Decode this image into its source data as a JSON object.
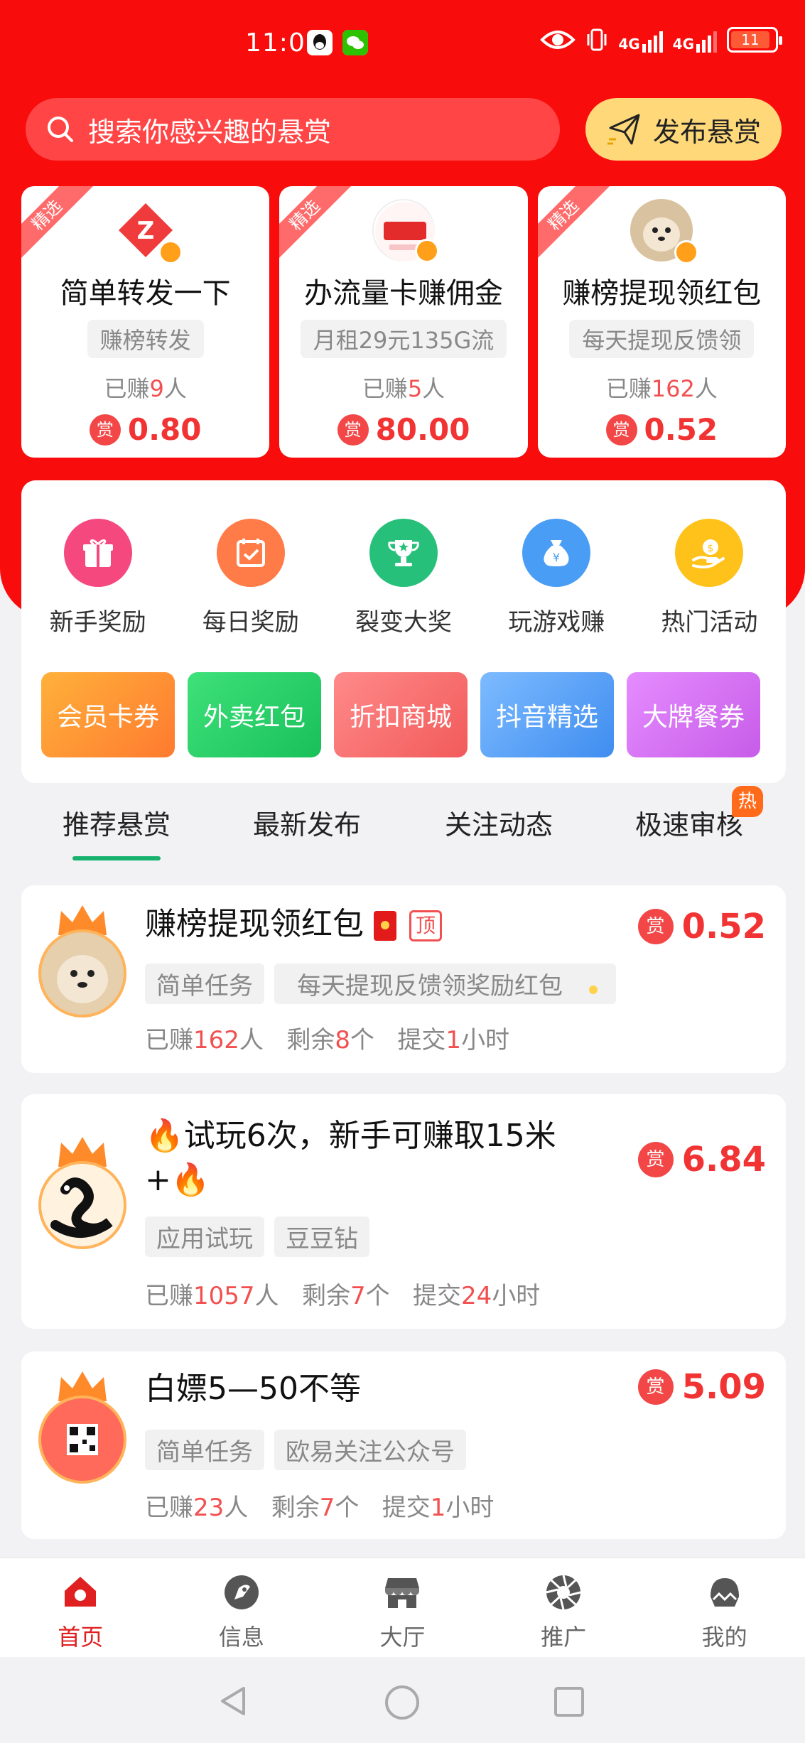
{
  "status_bar": {
    "time": "11:03",
    "net1": "4G",
    "net2": "4G",
    "battery": "11"
  },
  "search": {
    "placeholder": "搜索你感兴趣的悬赏"
  },
  "publish_button": "发布悬赏",
  "featured": [
    {
      "badge": "精选",
      "title": "简单转发一下",
      "tag": "赚榜转发",
      "earned_prefix": "已赚",
      "earned_count": "9",
      "earned_suffix": "人",
      "reward_icon": "赏",
      "amount": "0.80"
    },
    {
      "badge": "精选",
      "title": "办流量卡赚佣金",
      "tag": "月租29元135G流",
      "earned_prefix": "已赚",
      "earned_count": "5",
      "earned_suffix": "人",
      "reward_icon": "赏",
      "amount": "80.00"
    },
    {
      "badge": "精选",
      "title": "赚榜提现领红包",
      "tag": "每天提现反馈领",
      "earned_prefix": "已赚",
      "earned_count": "162",
      "earned_suffix": "人",
      "reward_icon": "赏",
      "amount": "0.52"
    }
  ],
  "quick_actions": [
    {
      "label": "新手奖励",
      "icon": "gift-icon",
      "color": "#f5487f"
    },
    {
      "label": "每日奖励",
      "icon": "calendar-check-icon",
      "color": "#ff7b47"
    },
    {
      "label": "裂变大奖",
      "icon": "trophy-icon",
      "color": "#27c07a"
    },
    {
      "label": "玩游戏赚",
      "icon": "money-bag-icon",
      "color": "#4a9df5"
    },
    {
      "label": "热门活动",
      "icon": "coin-hand-icon",
      "color": "#ffc21a"
    }
  ],
  "promo_pills": [
    "会员卡券",
    "外卖红包",
    "折扣商城",
    "抖音精选",
    "大牌餐券"
  ],
  "tabs": [
    "推荐悬赏",
    "最新发布",
    "关注动态",
    "极速审核"
  ],
  "hot_badge": "热",
  "tasks": [
    {
      "title": "赚榜提现领红包",
      "pin": "顶",
      "tags": [
        "简单任务",
        "每天提现反馈领奖励红包"
      ],
      "earned_label": "已赚",
      "earned": "162",
      "earned_unit": "人",
      "remain_label": "剩余",
      "remain": "8",
      "remain_unit": "个",
      "submit_label": "提交",
      "submit": "1",
      "submit_unit": "小时",
      "reward_icon": "赏",
      "amount": "0.52"
    },
    {
      "title": "🔥试玩6次，新手可赚取15米",
      "title2": "+🔥",
      "tags": [
        "应用试玩",
        "豆豆钻"
      ],
      "earned_label": "已赚",
      "earned": "1057",
      "earned_unit": "人",
      "remain_label": "剩余",
      "remain": "7",
      "remain_unit": "个",
      "submit_label": "提交",
      "submit": "24",
      "submit_unit": "小时",
      "reward_icon": "赏",
      "amount": "6.84"
    },
    {
      "title": "白嫖5—50不等",
      "tags": [
        "简单任务",
        "欧易关注公众号"
      ],
      "earned_label": "已赚",
      "earned": "23",
      "earned_unit": "人",
      "remain_label": "剩余",
      "remain": "7",
      "remain_unit": "个",
      "submit_label": "提交",
      "submit": "1",
      "submit_unit": "小时",
      "reward_icon": "赏",
      "amount": "5.09"
    }
  ],
  "bottom_nav": [
    {
      "label": "首页",
      "icon": "home-icon"
    },
    {
      "label": "信息",
      "icon": "message-icon"
    },
    {
      "label": "大厅",
      "icon": "store-icon"
    },
    {
      "label": "推广",
      "icon": "aperture-icon"
    },
    {
      "label": "我的",
      "icon": "profile-icon"
    }
  ],
  "colors": {
    "brand_red": "#f80c0c",
    "amount_red": "#f23333",
    "active_tab": "#16b26e"
  }
}
